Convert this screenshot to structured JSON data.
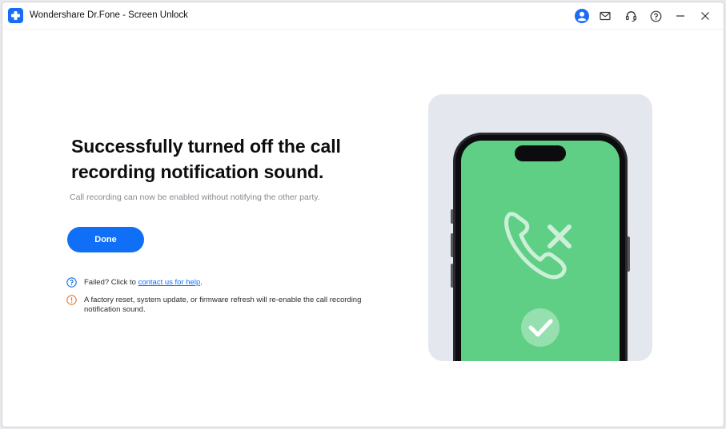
{
  "window": {
    "title": "Wondershare Dr.Fone - Screen Unlock"
  },
  "titlebar_icons": [
    "account-icon",
    "mail-icon",
    "support-headset-icon",
    "help-icon",
    "minimize-icon",
    "close-icon"
  ],
  "colors": {
    "accent": "#0f6ff7",
    "phone_screen": "#5fcf86",
    "warning": "#e8772e"
  },
  "main": {
    "headline": "Successfully turned off the call recording notification sound.",
    "subtext": "Call recording can now be enabled without notifying the other party.",
    "done_label": "Done",
    "help": {
      "prefix": "Failed? Click to ",
      "link": "contact us for help",
      "suffix": "."
    },
    "warning": "A factory reset, system update, or firmware refresh will re-enable the call recording notification sound."
  }
}
